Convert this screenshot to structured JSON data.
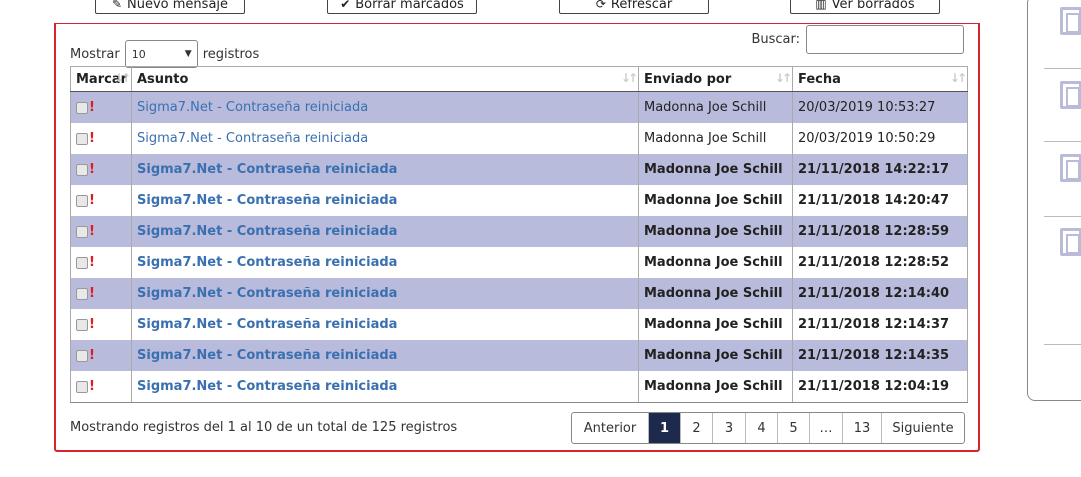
{
  "toolbar": {
    "new_message": "Nuevo mensaje",
    "delete_marked": "Borrar marcados",
    "refresh": "Refrescar",
    "view_deleted": "Ver borrados"
  },
  "length": {
    "label_before": "Mostrar",
    "value": "10",
    "label_after": "registros"
  },
  "search": {
    "label": "Buscar:",
    "value": ""
  },
  "columns": [
    "Marcar",
    "Asunto",
    "Enviado por",
    "Fecha"
  ],
  "rows": [
    {
      "subject": "Sigma7.Net - Contraseña reiniciada",
      "sender": "Madonna Joe Schill",
      "date": "20/03/2019 10:53:27",
      "unread": false
    },
    {
      "subject": "Sigma7.Net - Contraseña reiniciada",
      "sender": "Madonna Joe Schill",
      "date": "20/03/2019 10:50:29",
      "unread": false
    },
    {
      "subject": "Sigma7.Net - Contraseña reiniciada",
      "sender": "Madonna Joe Schill",
      "date": "21/11/2018 14:22:17",
      "unread": true
    },
    {
      "subject": "Sigma7.Net - Contraseña reiniciada",
      "sender": "Madonna Joe Schill",
      "date": "21/11/2018 14:20:47",
      "unread": true
    },
    {
      "subject": "Sigma7.Net - Contraseña reiniciada",
      "sender": "Madonna Joe Schill",
      "date": "21/11/2018 12:28:59",
      "unread": true
    },
    {
      "subject": "Sigma7.Net - Contraseña reiniciada",
      "sender": "Madonna Joe Schill",
      "date": "21/11/2018 12:28:52",
      "unread": true
    },
    {
      "subject": "Sigma7.Net - Contraseña reiniciada",
      "sender": "Madonna Joe Schill",
      "date": "21/11/2018 12:14:40",
      "unread": true
    },
    {
      "subject": "Sigma7.Net - Contraseña reiniciada",
      "sender": "Madonna Joe Schill",
      "date": "21/11/2018 12:14:37",
      "unread": true
    },
    {
      "subject": "Sigma7.Net - Contraseña reiniciada",
      "sender": "Madonna Joe Schill",
      "date": "21/11/2018 12:14:35",
      "unread": true
    },
    {
      "subject": "Sigma7.Net - Contraseña reiniciada",
      "sender": "Madonna Joe Schill",
      "date": "21/11/2018 12:04:19",
      "unread": true
    }
  ],
  "info": "Mostrando registros del 1 al 10 de un total de 125 registros",
  "pagination": {
    "previous": "Anterior",
    "pages": [
      "1",
      "2",
      "3",
      "4",
      "5",
      "…",
      "13"
    ],
    "current": "1",
    "next": "Siguiente"
  },
  "colors": {
    "accent": "#d9232e",
    "row_alt": "#b9bbdc",
    "link": "#3a70b0",
    "current_page": "#1d2a4d",
    "flag": "#e01b1b"
  },
  "icons": {
    "new_message": "pencil-icon",
    "delete_marked": "check-icon",
    "refresh": "refresh-icon",
    "view_deleted": "trash-icon",
    "side": "copy-icon"
  }
}
